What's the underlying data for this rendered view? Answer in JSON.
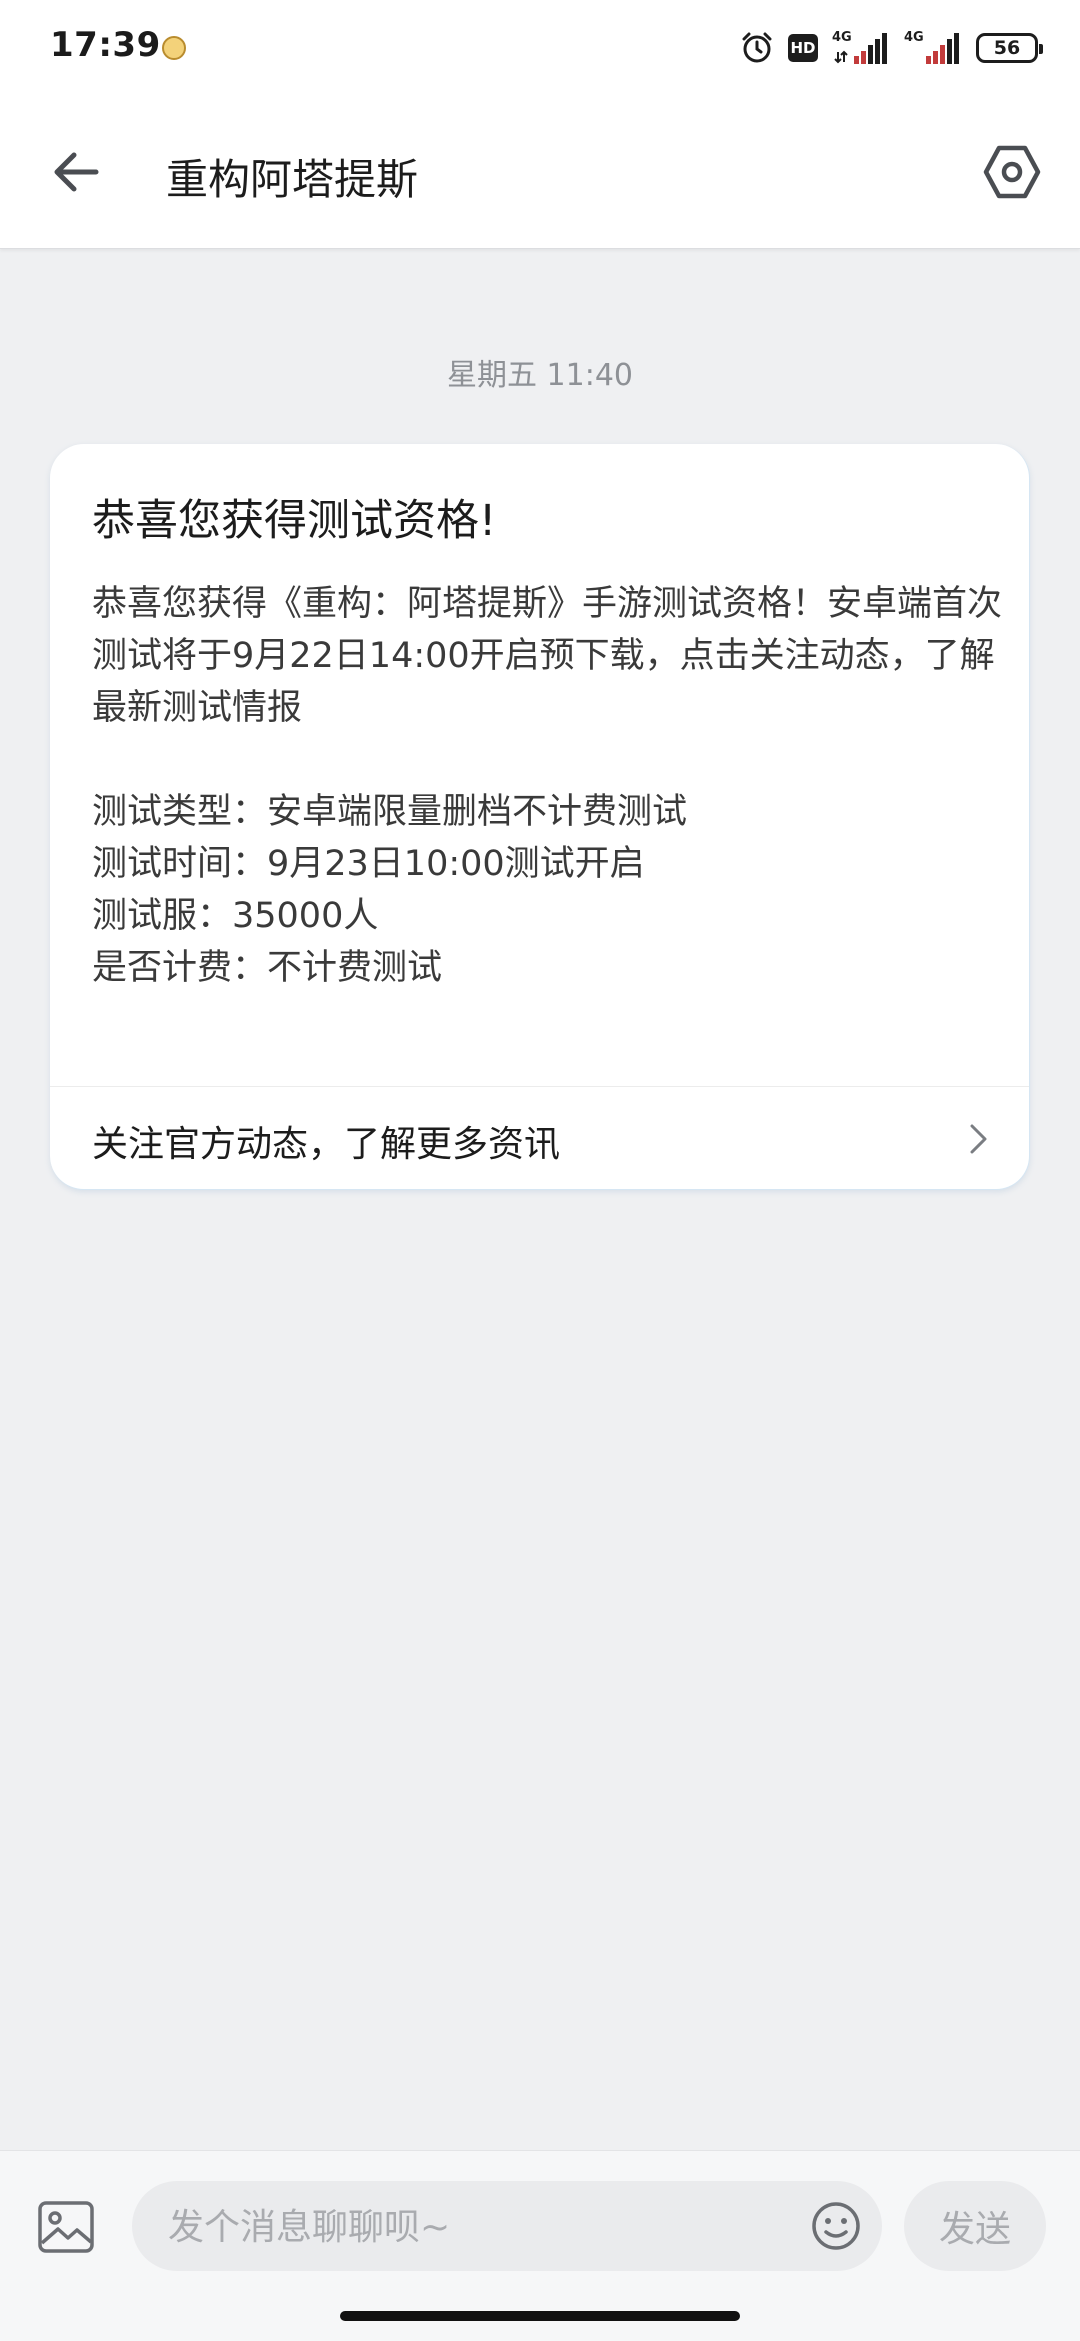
{
  "status_bar": {
    "time": "17:39",
    "hd_label": "HD",
    "network_1": "4G",
    "network_2": "4G",
    "battery_level": "56"
  },
  "header": {
    "title": "重构阿塔提斯",
    "back_icon": "arrow-left-icon",
    "settings_icon": "hexagon-settings-icon"
  },
  "chat": {
    "timestamp": "星期五 11:40",
    "message": {
      "title": "恭喜您获得测试资格!",
      "intro": "恭喜您获得《重构：阿塔提斯》手游测试资格！安卓端首次测试将于9月22日14:00开启预下载，点击关注动态，了解最新测试情报",
      "details": [
        "测试类型：安卓端限量删档不计费测试",
        "测试时间：9月23日10:00测试开启",
        "测试服：35000人",
        "是否计费：不计费测试"
      ],
      "link_label": "关注官方动态，了解更多资讯"
    }
  },
  "composer": {
    "placeholder": "发个消息聊聊呗~",
    "send_label": "发送",
    "image_icon": "image-icon",
    "emoji_icon": "smiley-icon"
  },
  "colors": {
    "page_background": "#eff0f2",
    "card_background": "#ffffff",
    "muted_text": "#8e9196",
    "send_disabled": "#a9abaf"
  }
}
